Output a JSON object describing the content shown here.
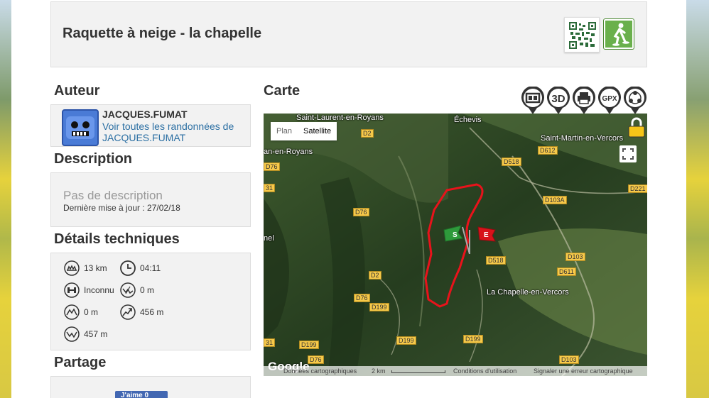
{
  "title": "Raquette à neige - la chapelle",
  "author": {
    "section_title": "Auteur",
    "name": "JACQUES.FUMAT",
    "link": "Voir toutes les randonnées de JACQUES.FUMAT"
  },
  "description": {
    "section_title": "Description",
    "text": "Pas de description",
    "updated": "Dernière mise à jour : 27/02/18"
  },
  "technical": {
    "section_title": "Détails techniques",
    "distance": "13 km",
    "duration": "04:11",
    "difficulty": "Inconnu",
    "descent": "0 m",
    "elevation_min": "0 m",
    "ascent": "456 m",
    "elevation_max": "457 m"
  },
  "share": {
    "section_title": "Partage",
    "like_label": "J'aime 0"
  },
  "map": {
    "section_title": "Carte",
    "buttons": [
      "screen-icon",
      "3d-icon",
      "print-icon",
      "gpx-icon",
      "share-icon"
    ],
    "btn_3d": "3D",
    "btn_gpx": "GPX",
    "type_plan": "Plan",
    "type_satellite": "Satellite",
    "places": {
      "saint_laurent": "Saint-Laurent-en-Royans",
      "echevis": "Échevis",
      "saint_martin": "Saint-Martin-en-Vercors",
      "royans": "an-en-Royans",
      "chapelle": "La Chapelle-en-Vercors",
      "nel": "nel"
    },
    "roads": {
      "d2a": "D2",
      "d612": "D612",
      "d76a": "D76",
      "d518a": "D518",
      "d31a": "31",
      "d221": "D221",
      "d103a": "D103A",
      "d76b": "D76",
      "d103b": "D103",
      "d518b": "D518",
      "d2b": "D2",
      "d611": "D611",
      "d76c": "D76",
      "d199a": "D199",
      "d31b": "31",
      "d199b": "D199",
      "d199c": "D199",
      "d199d": "D199",
      "d76d": "D76",
      "d103c": "D103"
    },
    "markers": {
      "start": "S",
      "end": "E"
    },
    "google": "Google",
    "footer": {
      "data": "Données cartographiques",
      "scale": "2 km",
      "terms": "Conditions d'utilisation",
      "report": "Signaler une erreur cartographique"
    }
  }
}
